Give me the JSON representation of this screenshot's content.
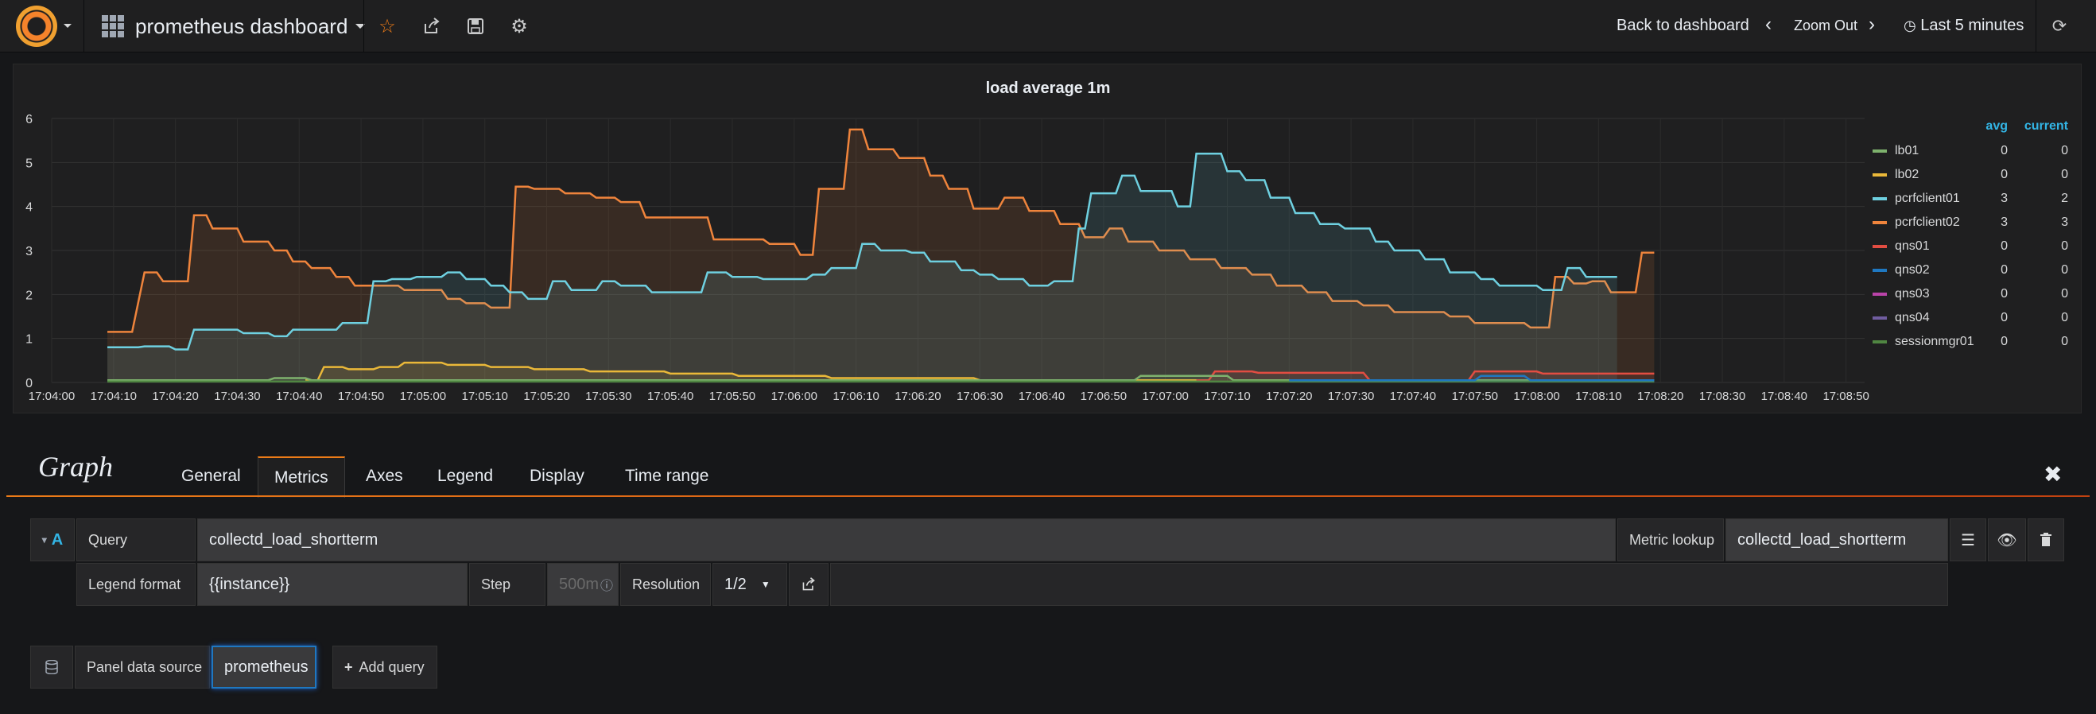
{
  "nav": {
    "dashboard_title": "prometheus dashboard",
    "back_label": "Back to dashboard",
    "zoom_label": "Zoom Out",
    "time_label": "Last 5 minutes"
  },
  "panel": {
    "title": "load average 1m"
  },
  "legend": {
    "avg_header": "avg",
    "current_header": "current",
    "items": [
      {
        "name": "lb01",
        "avg": "0",
        "current": "0",
        "color": "#7eb26d"
      },
      {
        "name": "lb02",
        "avg": "0",
        "current": "0",
        "color": "#eab839"
      },
      {
        "name": "pcrfclient01",
        "avg": "3",
        "current": "2",
        "color": "#6ed0e0"
      },
      {
        "name": "pcrfclient02",
        "avg": "3",
        "current": "3",
        "color": "#ef843c"
      },
      {
        "name": "qns01",
        "avg": "0",
        "current": "0",
        "color": "#e24d42"
      },
      {
        "name": "qns02",
        "avg": "0",
        "current": "0",
        "color": "#1f78c1"
      },
      {
        "name": "qns03",
        "avg": "0",
        "current": "0",
        "color": "#ba43a9"
      },
      {
        "name": "qns04",
        "avg": "0",
        "current": "0",
        "color": "#705da0"
      },
      {
        "name": "sessionmgr01",
        "avg": "0",
        "current": "0",
        "color": "#508642"
      }
    ]
  },
  "chart_data": {
    "type": "area",
    "title": "load average 1m",
    "ylim": [
      0,
      6
    ],
    "y_ticks": [
      "0",
      "1",
      "2",
      "3",
      "4",
      "5",
      "6"
    ],
    "x_ticks": [
      "17:04:00",
      "17:04:10",
      "17:04:20",
      "17:04:30",
      "17:04:40",
      "17:04:50",
      "17:05:00",
      "17:05:10",
      "17:05:20",
      "17:05:30",
      "17:05:40",
      "17:05:50",
      "17:06:00",
      "17:06:10",
      "17:06:20",
      "17:06:30",
      "17:06:40",
      "17:06:50",
      "17:07:00",
      "17:07:10",
      "17:07:20",
      "17:07:30",
      "17:07:40",
      "17:07:50",
      "17:08:00",
      "17:08:10",
      "17:08:20",
      "17:08:30",
      "17:08:40",
      "17:08:50"
    ],
    "x_start_seconds": 240,
    "x_end_seconds": 533,
    "x_units": "seconds after 17:00:00",
    "grid": true,
    "legend_position": "right",
    "series": [
      {
        "name": "pcrfclient02",
        "color": "#ef843c",
        "points": [
          [
            249,
            1.15
          ],
          [
            253,
            1.15
          ],
          [
            255,
            2.5
          ],
          [
            257,
            2.5
          ],
          [
            258,
            2.3
          ],
          [
            262,
            2.3
          ],
          [
            263,
            3.8
          ],
          [
            265,
            3.8
          ],
          [
            266,
            3.5
          ],
          [
            270,
            3.5
          ],
          [
            271,
            3.2
          ],
          [
            275,
            3.2
          ],
          [
            276,
            3.0
          ],
          [
            278,
            3.0
          ],
          [
            279,
            2.75
          ],
          [
            281,
            2.75
          ],
          [
            282,
            2.6
          ],
          [
            285,
            2.6
          ],
          [
            286,
            2.4
          ],
          [
            288,
            2.4
          ],
          [
            289,
            2.2
          ],
          [
            296,
            2.2
          ],
          [
            297,
            2.1
          ],
          [
            303,
            2.1
          ],
          [
            304,
            1.9
          ],
          [
            306,
            1.9
          ],
          [
            307,
            1.8
          ],
          [
            310,
            1.8
          ],
          [
            311,
            1.7
          ],
          [
            314,
            1.7
          ],
          [
            315,
            4.45
          ],
          [
            317,
            4.45
          ],
          [
            318,
            4.4
          ],
          [
            322,
            4.4
          ],
          [
            323,
            4.3
          ],
          [
            327,
            4.3
          ],
          [
            328,
            4.2
          ],
          [
            331,
            4.2
          ],
          [
            332,
            4.1
          ],
          [
            335,
            4.1
          ],
          [
            336,
            3.75
          ],
          [
            346,
            3.75
          ],
          [
            347,
            3.25
          ],
          [
            355,
            3.25
          ],
          [
            356,
            3.15
          ],
          [
            360,
            3.15
          ],
          [
            361,
            2.9
          ],
          [
            363,
            2.9
          ],
          [
            364,
            4.4
          ],
          [
            368,
            4.4
          ],
          [
            369,
            5.75
          ],
          [
            371,
            5.75
          ],
          [
            372,
            5.3
          ],
          [
            376,
            5.3
          ],
          [
            377,
            5.1
          ],
          [
            381,
            5.1
          ],
          [
            382,
            4.7
          ],
          [
            384,
            4.7
          ],
          [
            385,
            4.4
          ],
          [
            388,
            4.4
          ],
          [
            389,
            3.95
          ],
          [
            393,
            3.95
          ],
          [
            394,
            4.2
          ],
          [
            397,
            4.2
          ],
          [
            398,
            3.9
          ],
          [
            402,
            3.9
          ],
          [
            403,
            3.6
          ],
          [
            406,
            3.6
          ],
          [
            407,
            3.3
          ],
          [
            410,
            3.3
          ],
          [
            411,
            3.5
          ],
          [
            413,
            3.5
          ],
          [
            414,
            3.2
          ],
          [
            418,
            3.2
          ],
          [
            419,
            3.0
          ],
          [
            423,
            3.0
          ],
          [
            424,
            2.8
          ],
          [
            428,
            2.8
          ],
          [
            429,
            2.6
          ],
          [
            433,
            2.6
          ],
          [
            434,
            2.45
          ],
          [
            437,
            2.45
          ],
          [
            438,
            2.2
          ],
          [
            442,
            2.2
          ],
          [
            443,
            2.05
          ],
          [
            446,
            2.05
          ],
          [
            447,
            1.85
          ],
          [
            451,
            1.85
          ],
          [
            452,
            1.75
          ],
          [
            456,
            1.75
          ],
          [
            457,
            1.6
          ],
          [
            465,
            1.6
          ],
          [
            466,
            1.5
          ],
          [
            469,
            1.5
          ],
          [
            470,
            1.35
          ],
          [
            478,
            1.35
          ],
          [
            479,
            1.25
          ],
          [
            482,
            1.25
          ],
          [
            483,
            2.4
          ],
          [
            485,
            2.4
          ],
          [
            486,
            2.25
          ],
          [
            488,
            2.25
          ],
          [
            489,
            2.3
          ],
          [
            491,
            2.3
          ],
          [
            492,
            2.05
          ],
          [
            496,
            2.05
          ],
          [
            497,
            2.95
          ],
          [
            499,
            2.95
          ]
        ]
      },
      {
        "name": "pcrfclient01",
        "color": "#6ed0e0",
        "points": [
          [
            249,
            0.8
          ],
          [
            254,
            0.8
          ],
          [
            255,
            0.82
          ],
          [
            259,
            0.82
          ],
          [
            260,
            0.75
          ],
          [
            262,
            0.75
          ],
          [
            263,
            1.2
          ],
          [
            270,
            1.2
          ],
          [
            271,
            1.12
          ],
          [
            275,
            1.12
          ],
          [
            276,
            1.05
          ],
          [
            278,
            1.05
          ],
          [
            279,
            1.2
          ],
          [
            286,
            1.2
          ],
          [
            287,
            1.35
          ],
          [
            291,
            1.35
          ],
          [
            292,
            2.3
          ],
          [
            294,
            2.3
          ],
          [
            295,
            2.35
          ],
          [
            298,
            2.35
          ],
          [
            299,
            2.4
          ],
          [
            303,
            2.4
          ],
          [
            304,
            2.5
          ],
          [
            306,
            2.5
          ],
          [
            307,
            2.35
          ],
          [
            310,
            2.35
          ],
          [
            311,
            2.2
          ],
          [
            313,
            2.2
          ],
          [
            314,
            2.05
          ],
          [
            316,
            2.05
          ],
          [
            317,
            1.9
          ],
          [
            320,
            1.9
          ],
          [
            321,
            2.3
          ],
          [
            323,
            2.3
          ],
          [
            324,
            2.1
          ],
          [
            328,
            2.1
          ],
          [
            329,
            2.3
          ],
          [
            331,
            2.3
          ],
          [
            332,
            2.2
          ],
          [
            336,
            2.2
          ],
          [
            337,
            2.05
          ],
          [
            345,
            2.05
          ],
          [
            346,
            2.5
          ],
          [
            349,
            2.5
          ],
          [
            350,
            2.4
          ],
          [
            354,
            2.4
          ],
          [
            355,
            2.35
          ],
          [
            362,
            2.35
          ],
          [
            363,
            2.45
          ],
          [
            365,
            2.45
          ],
          [
            366,
            2.6
          ],
          [
            370,
            2.6
          ],
          [
            371,
            3.15
          ],
          [
            373,
            3.15
          ],
          [
            374,
            3.0
          ],
          [
            378,
            3.0
          ],
          [
            379,
            2.95
          ],
          [
            381,
            2.95
          ],
          [
            382,
            2.75
          ],
          [
            386,
            2.75
          ],
          [
            387,
            2.55
          ],
          [
            389,
            2.55
          ],
          [
            390,
            2.45
          ],
          [
            392,
            2.45
          ],
          [
            393,
            2.35
          ],
          [
            397,
            2.35
          ],
          [
            398,
            2.2
          ],
          [
            401,
            2.2
          ],
          [
            402,
            2.3
          ],
          [
            405,
            2.3
          ],
          [
            406,
            3.5
          ],
          [
            407,
            3.5
          ],
          [
            408,
            4.3
          ],
          [
            412,
            4.3
          ],
          [
            413,
            4.7
          ],
          [
            415,
            4.7
          ],
          [
            416,
            4.35
          ],
          [
            421,
            4.35
          ],
          [
            422,
            4.0
          ],
          [
            424,
            4.0
          ],
          [
            425,
            5.2
          ],
          [
            429,
            5.2
          ],
          [
            430,
            4.8
          ],
          [
            432,
            4.8
          ],
          [
            433,
            4.6
          ],
          [
            436,
            4.6
          ],
          [
            437,
            4.2
          ],
          [
            440,
            4.2
          ],
          [
            441,
            3.85
          ],
          [
            444,
            3.85
          ],
          [
            445,
            3.6
          ],
          [
            448,
            3.6
          ],
          [
            449,
            3.5
          ],
          [
            453,
            3.5
          ],
          [
            454,
            3.2
          ],
          [
            456,
            3.2
          ],
          [
            457,
            3.0
          ],
          [
            461,
            3.0
          ],
          [
            462,
            2.8
          ],
          [
            465,
            2.8
          ],
          [
            466,
            2.5
          ],
          [
            470,
            2.5
          ],
          [
            471,
            2.35
          ],
          [
            473,
            2.35
          ],
          [
            474,
            2.2
          ],
          [
            480,
            2.2
          ],
          [
            481,
            2.1
          ],
          [
            484,
            2.1
          ],
          [
            485,
            2.6
          ],
          [
            487,
            2.6
          ],
          [
            488,
            2.4
          ],
          [
            493,
            2.4
          ]
        ]
      },
      {
        "name": "lb02",
        "color": "#eab839",
        "points": [
          [
            281,
            0.05
          ],
          [
            283,
            0.05
          ],
          [
            284,
            0.35
          ],
          [
            287,
            0.35
          ],
          [
            288,
            0.3
          ],
          [
            292,
            0.3
          ],
          [
            293,
            0.35
          ],
          [
            296,
            0.35
          ],
          [
            297,
            0.45
          ],
          [
            303,
            0.45
          ],
          [
            304,
            0.4
          ],
          [
            310,
            0.4
          ],
          [
            311,
            0.35
          ],
          [
            317,
            0.35
          ],
          [
            318,
            0.3
          ],
          [
            326,
            0.3
          ],
          [
            327,
            0.25
          ],
          [
            339,
            0.25
          ],
          [
            340,
            0.2
          ],
          [
            350,
            0.2
          ],
          [
            351,
            0.15
          ],
          [
            365,
            0.15
          ],
          [
            366,
            0.1
          ],
          [
            389,
            0.1
          ],
          [
            390,
            0.05
          ],
          [
            427,
            0.05
          ]
        ]
      },
      {
        "name": "qns01",
        "color": "#e24d42",
        "points": [
          [
            425,
            0.05
          ],
          [
            427,
            0.05
          ],
          [
            428,
            0.25
          ],
          [
            434,
            0.25
          ],
          [
            435,
            0.22
          ],
          [
            452,
            0.22
          ],
          [
            453,
            0.05
          ],
          [
            469,
            0.05
          ],
          [
            470,
            0.25
          ],
          [
            480,
            0.25
          ],
          [
            481,
            0.2
          ],
          [
            499,
            0.2
          ]
        ]
      },
      {
        "name": "lb01",
        "color": "#7eb26d",
        "points": [
          [
            249,
            0.05
          ],
          [
            275,
            0.05
          ],
          [
            276,
            0.1
          ],
          [
            281,
            0.1
          ],
          [
            282,
            0.05
          ],
          [
            350,
            0.05
          ],
          [
            351,
            0.05
          ],
          [
            415,
            0.05
          ],
          [
            416,
            0.15
          ],
          [
            430,
            0.15
          ],
          [
            431,
            0.05
          ],
          [
            499,
            0.05
          ]
        ]
      },
      {
        "name": "sessionmgr01",
        "color": "#508642",
        "points": [
          [
            249,
            0.02
          ],
          [
            499,
            0.02
          ]
        ]
      },
      {
        "name": "qns02",
        "color": "#1f78c1",
        "points": [
          [
            440,
            0.05
          ],
          [
            470,
            0.05
          ],
          [
            471,
            0.15
          ],
          [
            478,
            0.15
          ],
          [
            479,
            0.05
          ],
          [
            499,
            0.05
          ]
        ]
      }
    ]
  },
  "editor": {
    "title": "Graph",
    "tabs": [
      "General",
      "Metrics",
      "Axes",
      "Legend",
      "Display",
      "Time range"
    ],
    "active_tab": "Metrics",
    "query_ref": "A",
    "query_label": "Query",
    "query_value": "collectd_load_shortterm",
    "metric_lookup_label": "Metric lookup",
    "metric_lookup_value": "collectd_load_shortterm",
    "legend_format_label": "Legend format",
    "legend_format_value": "{{instance}}",
    "step_label": "Step",
    "step_placeholder": "500m",
    "resolution_label": "Resolution",
    "resolution_value": "1/2",
    "datasource_label": "Panel data source",
    "datasource_value": "prometheus",
    "add_query_label": "Add query"
  }
}
